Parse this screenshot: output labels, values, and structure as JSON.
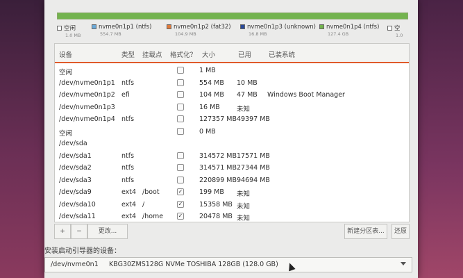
{
  "legend": [
    {
      "name": "空闲",
      "size": "1.0 MB",
      "color": "#ffffff"
    },
    {
      "name": "nvme0n1p1 (ntfs)",
      "size": "554.7 MB",
      "color": "#6aa9d8"
    },
    {
      "name": "nvme0n1p2 (fat32)",
      "size": "104.9 MB",
      "color": "#e07a3a"
    },
    {
      "name": "nvme0n1p3 (unknown)",
      "size": "16.8 MB",
      "color": "#2a4a9a"
    },
    {
      "name": "nvme0n1p4 (ntfs)",
      "size": "127.4 GB",
      "color": "#73b34e"
    },
    {
      "name": "空",
      "size": "1.0",
      "color": "#ffffff"
    }
  ],
  "colors": {
    "accent": "#e05a2a",
    "bar": "#73b34e"
  },
  "headers": {
    "device": "设备",
    "type": "类型",
    "mount": "挂载点",
    "format": "格式化？",
    "size": "大小",
    "used": "已用",
    "system": "已装系统"
  },
  "rows": [
    {
      "device": "空闲",
      "type": "",
      "mount": "",
      "check": "",
      "size": "1 MB",
      "used": "",
      "system": ""
    },
    {
      "device": "/dev/nvme0n1p1",
      "type": "ntfs",
      "mount": "",
      "check": "",
      "size": "554 MB",
      "used": "10 MB",
      "system": ""
    },
    {
      "device": "/dev/nvme0n1p2",
      "type": "efi",
      "mount": "",
      "check": "",
      "size": "104 MB",
      "used": "47 MB",
      "system": "Windows Boot Manager"
    },
    {
      "device": "/dev/nvme0n1p3",
      "type": "",
      "mount": "",
      "check": "",
      "size": "16 MB",
      "used": "未知",
      "system": ""
    },
    {
      "device": "/dev/nvme0n1p4",
      "type": "ntfs",
      "mount": "",
      "check": "",
      "size": "127357 MB",
      "used": "49397 MB",
      "system": ""
    },
    {
      "device": "空闲",
      "type": "",
      "mount": "",
      "check": "",
      "size": "0 MB",
      "used": "",
      "system": ""
    },
    {
      "device": "/dev/sda",
      "type": "",
      "mount": "",
      "check": "none",
      "size": "",
      "used": "",
      "system": ""
    },
    {
      "device": "/dev/sda1",
      "type": "ntfs",
      "mount": "",
      "check": "",
      "size": "314572 MB",
      "used": "17571 MB",
      "system": ""
    },
    {
      "device": "/dev/sda2",
      "type": "ntfs",
      "mount": "",
      "check": "",
      "size": "314571 MB",
      "used": "27344 MB",
      "system": ""
    },
    {
      "device": "/dev/sda3",
      "type": "ntfs",
      "mount": "",
      "check": "",
      "size": "220899 MB",
      "used": "94694 MB",
      "system": ""
    },
    {
      "device": "/dev/sda9",
      "type": "ext4",
      "mount": "/boot",
      "check": "✓",
      "size": "199 MB",
      "used": "未知",
      "system": ""
    },
    {
      "device": "/dev/sda10",
      "type": "ext4",
      "mount": "/",
      "check": "✓",
      "size": "15358 MB",
      "used": "未知",
      "system": ""
    },
    {
      "device": "/dev/sda11",
      "type": "ext4",
      "mount": "/home",
      "check": "✓",
      "size": "20478 MB",
      "used": "未知",
      "system": ""
    }
  ],
  "toolbar": {
    "add": "+",
    "remove": "−",
    "change": "更改...",
    "new_table": "新建分区表...",
    "revert": "还原"
  },
  "boot": {
    "label": "安装启动引导器的设备：",
    "device": "/dev/nvme0n1",
    "model": "KBG30ZMS128G NVMe TOSHIBA 128GB (128.0 GB)"
  }
}
